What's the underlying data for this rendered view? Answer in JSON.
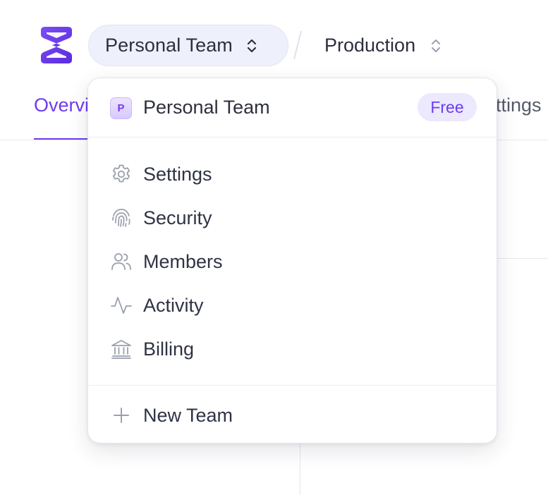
{
  "header": {
    "team_switcher_label": "Personal Team",
    "environment_label": "Production",
    "logo_icon": "brand-logo-icon",
    "chevron_icon": "chevron-up-down-icon"
  },
  "tabs": {
    "overview_fragment": "Overview",
    "settings_fragment": "Settings"
  },
  "dropdown": {
    "current_team": {
      "avatar_letter": "P",
      "name": "Personal Team",
      "plan_badge": "Free"
    },
    "items": [
      {
        "label": "Settings",
        "icon": "gear-icon"
      },
      {
        "label": "Security",
        "icon": "fingerprint-icon"
      },
      {
        "label": "Members",
        "icon": "users-icon"
      },
      {
        "label": "Activity",
        "icon": "activity-icon"
      },
      {
        "label": "Billing",
        "icon": "bank-icon"
      }
    ],
    "new_team": {
      "label": "New Team",
      "icon": "plus-icon"
    }
  },
  "colors": {
    "accent": "#6d3cf0",
    "text": "#2d2f3e",
    "icon": "#9a9fae",
    "switcher_bg": "#eef0fb",
    "badge_bg": "#ece8fd"
  }
}
